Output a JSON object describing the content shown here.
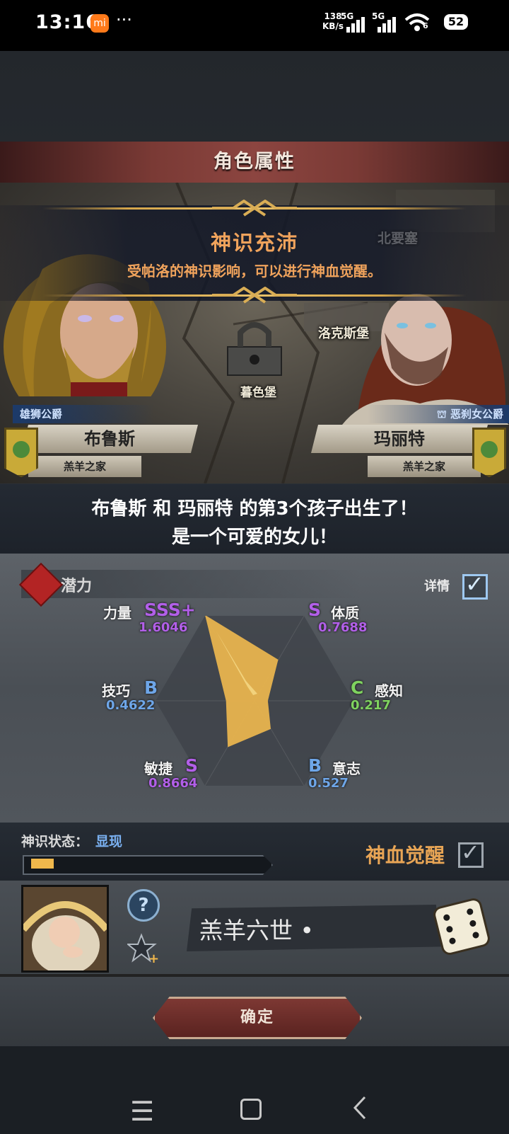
{
  "status_bar": {
    "time": "13:16",
    "app_icon": "mi",
    "more": "···",
    "net_speed": "138",
    "net_unit": "KB/s",
    "sig1": "5G",
    "sig2": "5G",
    "wifi_badge": "6",
    "battery": "52"
  },
  "title": "角色属性",
  "banner": {
    "title": "神识充沛",
    "subtitle": "受帕洛的神识影响，可以进行神血觉醒。"
  },
  "map": {
    "castle_left": "暮色堡",
    "castle_right": "洛克斯堡",
    "faded": "北要塞"
  },
  "father": {
    "rank": "雄狮公爵",
    "name": "布鲁斯",
    "house": "羔羊之家"
  },
  "mother": {
    "rank": "恶刹女公爵",
    "name": "玛丽特",
    "house": "羔羊之家"
  },
  "birth": {
    "line1": "布鲁斯 和 玛丽特 的第3个孩子出生了！",
    "line2": "是一个可爱的女儿！"
  },
  "potential": {
    "label": "潜力",
    "detail_label": "详情",
    "detail_checked": true,
    "stats": [
      {
        "name": "力量",
        "grade": "SSS+",
        "value": "1.6046"
      },
      {
        "name": "体质",
        "grade": "S",
        "value": "0.7688"
      },
      {
        "name": "感知",
        "grade": "C",
        "value": "0.217"
      },
      {
        "name": "意志",
        "grade": "B",
        "value": "0.527"
      },
      {
        "name": "敏捷",
        "grade": "S",
        "value": "0.8664"
      },
      {
        "name": "技巧",
        "grade": "B",
        "value": "0.4622"
      }
    ]
  },
  "divine": {
    "status_label": "神识状态：",
    "status_value": "显现",
    "progress": 0.09,
    "awaken_label": "神血觉醒",
    "awaken_checked": true
  },
  "child": {
    "name": "羔羊六世 •"
  },
  "confirm_label": "确定",
  "colors": {
    "accent_orange": "#f0a35c",
    "grade_s": "#b25fe8",
    "grade_b": "#6ea6e8",
    "grade_c": "#7fd25f",
    "radar_fill": "#e8b44e"
  }
}
